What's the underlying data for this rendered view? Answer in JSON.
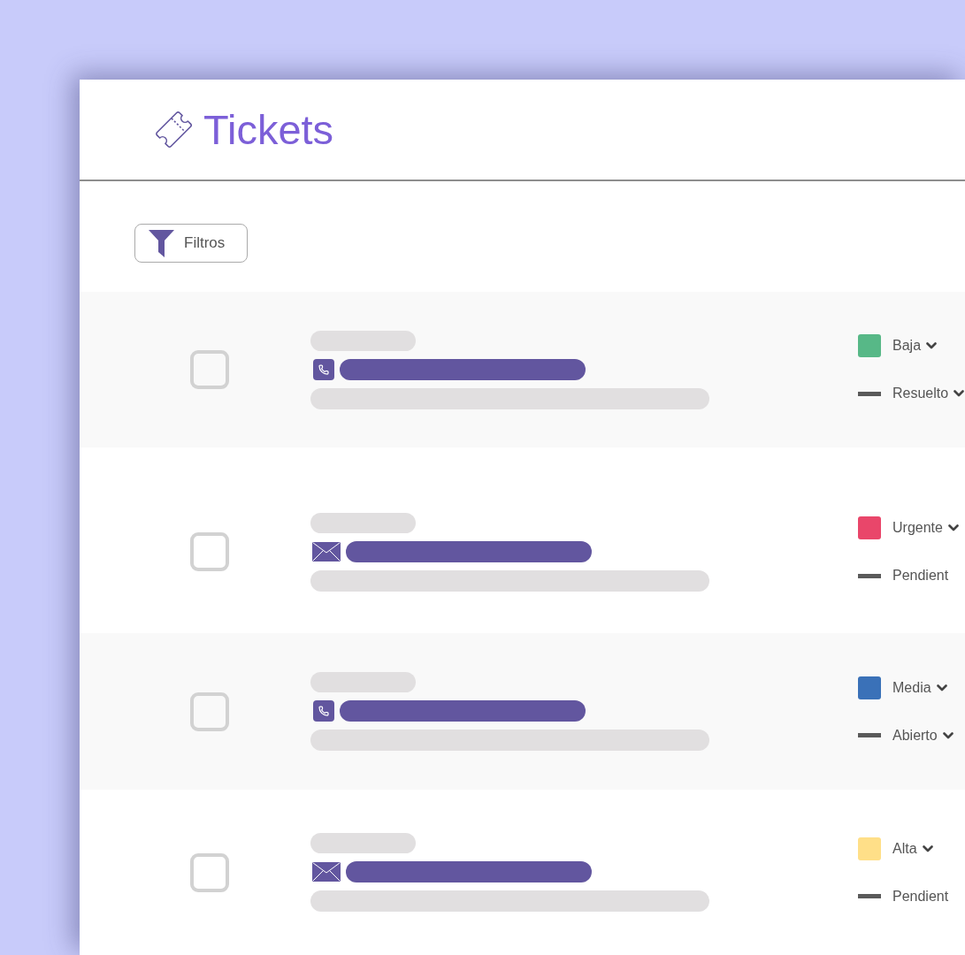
{
  "header": {
    "title": "Tickets"
  },
  "toolbar": {
    "filter_button": {
      "label": "Filtros"
    }
  },
  "tickets": [
    {
      "checked": false,
      "kind": "phone",
      "priority": {
        "label": "Baja",
        "color": "#57b887",
        "caret": true
      },
      "status": {
        "label": "Resuelto",
        "caret": true
      }
    },
    {
      "checked": false,
      "kind": "email",
      "priority": {
        "label": "Urgente",
        "color": "#e9466a",
        "caret": true
      },
      "status": {
        "label": "Pendient",
        "caret": false
      }
    },
    {
      "checked": false,
      "kind": "phone",
      "priority": {
        "label": "Media",
        "color": "#3a71b8",
        "caret": true
      },
      "status": {
        "label": "Abierto",
        "caret": true
      }
    },
    {
      "checked": false,
      "kind": "email",
      "priority": {
        "label": "Alta",
        "color": "#ffdf88",
        "caret": true
      },
      "status": {
        "label": "Pendient",
        "caret": false
      }
    }
  ]
}
